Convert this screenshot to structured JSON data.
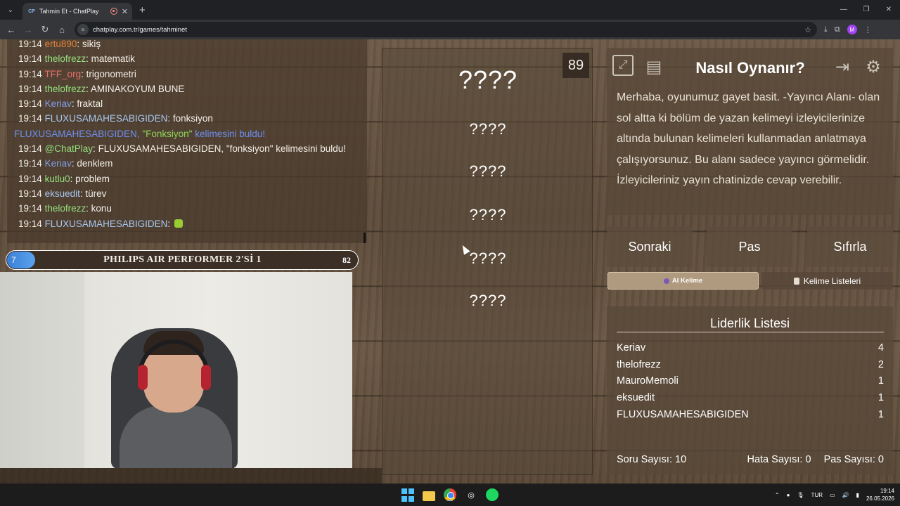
{
  "browser": {
    "tab_title": "Tahmin Et - ChatPlay",
    "tab_favicon": "CP",
    "url": "chatplay.com.tr/games/tahminet",
    "profile_initial": "M"
  },
  "chat": {
    "messages": [
      {
        "time": "19:14",
        "user": "ertu890",
        "color": "orange",
        "text": "sikiş"
      },
      {
        "time": "19:14",
        "user": "thelofrezz",
        "color": "green",
        "text": "matematik"
      },
      {
        "time": "19:14",
        "user": "TFF_org",
        "color": "red",
        "text": "trigonometri"
      },
      {
        "time": "19:14",
        "user": "thelofrezz",
        "color": "green",
        "text": "AMINAKOYUM BUNE"
      },
      {
        "time": "19:14",
        "user": "Keriav",
        "color": "blue",
        "text": "fraktal"
      },
      {
        "time": "19:14",
        "user": "FLUXUSAMAHESABIGIDEN",
        "color": "lblue",
        "text": "fonksiyon"
      }
    ],
    "system_notice": {
      "user": "FLUXUSAMAHESABIGIDEN,",
      "word": "\"Fonksiyon\"",
      "rest": "kelimesini buldu!"
    },
    "messages2": [
      {
        "time": "19:14",
        "user": "@ChatPlay",
        "color": "green",
        "text": "FLUXUSAMAHESABIGIDEN, \"fonksiyon\" kelimesini buldu!"
      },
      {
        "time": "19:14",
        "user": "Keriav",
        "color": "blue",
        "text": "denklem"
      },
      {
        "time": "19:14",
        "user": "kutlu0",
        "color": "green",
        "text": "problem"
      },
      {
        "time": "19:14",
        "user": "eksuedit",
        "color": "lblue",
        "text": "türev"
      },
      {
        "time": "19:14",
        "user": "thelofrezz",
        "color": "green",
        "text": "konu"
      },
      {
        "time": "19:14",
        "user": "FLUXUSAMAHESABIGIDEN",
        "color": "lblue",
        "text": ""
      }
    ]
  },
  "overlay": {
    "left_number": "7",
    "title": "PHILIPS AIR PERFORMER 2'Sİ 1",
    "right_number": "82"
  },
  "game": {
    "timer": "89",
    "words": [
      "????",
      "????",
      "????",
      "????",
      "????",
      "????"
    ]
  },
  "how_to": {
    "title": "Nasıl Oynanır?",
    "text": "Merhaba, oyunumuz gayet basit. -Yayıncı Alanı- olan sol altta ki bölüm de yazan kelimeyi izleyicilerinize altında bulunan kelimeleri kullanmadan anlatmaya çalışıyorsunuz. Bu alanı sadece yayıncı görmelidir. İzleyicileriniz yayın chatinizde cevap verebilir."
  },
  "actions": {
    "next": "Sonraki",
    "pass": "Pas",
    "reset": "Sıfırla"
  },
  "tabs": {
    "ai": "AI Kelime",
    "lists": "Kelime Listeleri"
  },
  "leaderboard": {
    "title": "Liderlik Listesi",
    "rows": [
      {
        "name": "Keriav",
        "score": "4"
      },
      {
        "name": "thelofrezz",
        "score": "2"
      },
      {
        "name": "MauroMemoli",
        "score": "1"
      },
      {
        "name": "eksuedit",
        "score": "1"
      },
      {
        "name": "FLUXUSAMAHESABIGIDEN",
        "score": "1"
      }
    ],
    "question_count": "Soru Sayısı: 10",
    "error_count": "Hata Sayısı: 0",
    "pass_count": "Pas Sayısı: 0"
  },
  "taskbar": {
    "lang": "TUR",
    "time": "19:14",
    "date": "26.05.2026"
  },
  "colors": {
    "orange": "#e2823c",
    "green": "#94e07d",
    "red": "#e8706a",
    "blue": "#7fa0e8",
    "lblue": "#a8c8f0"
  }
}
